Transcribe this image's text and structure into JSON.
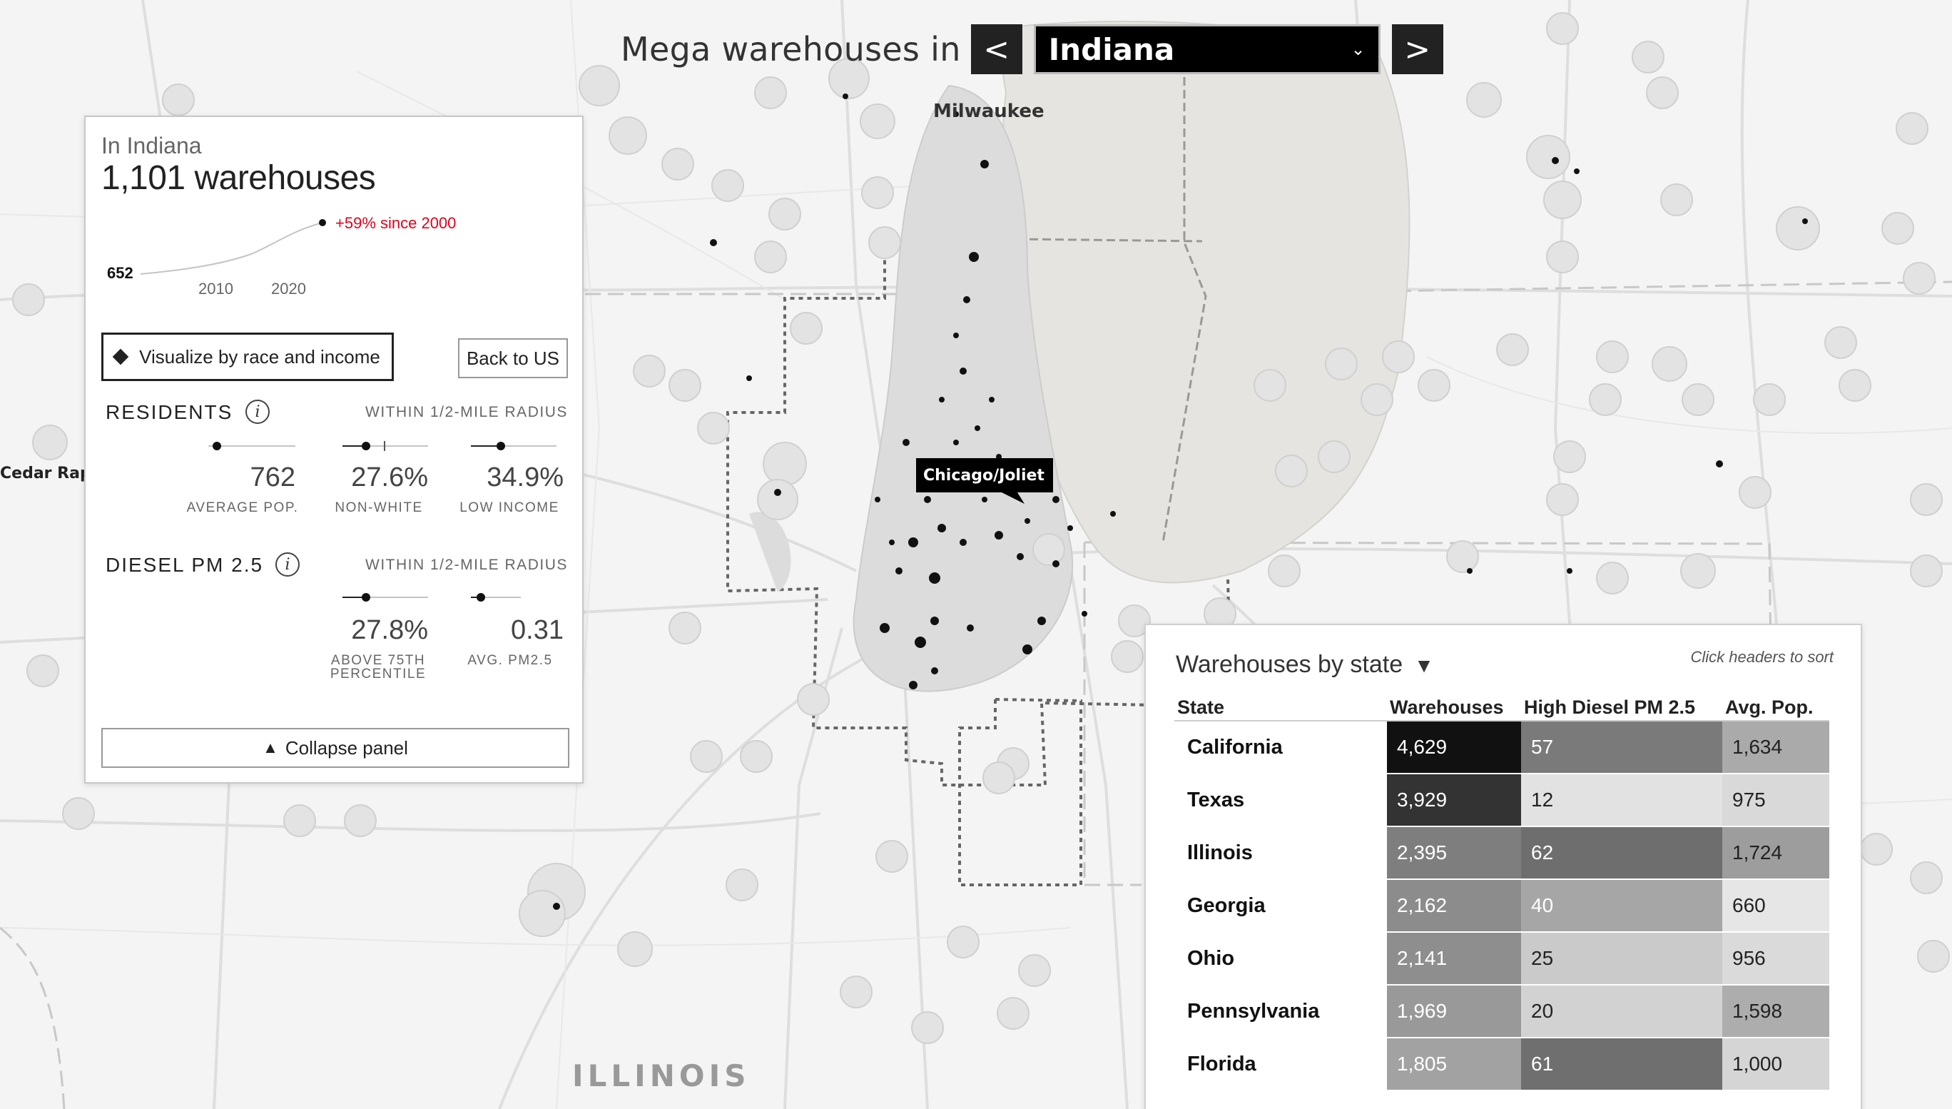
{
  "header": {
    "title": "Mega warehouses in",
    "prev_label": "<",
    "next_label": ">",
    "selected_state": "Indiana"
  },
  "map": {
    "labels": {
      "milwaukee": "Milwaukee",
      "cedar_rapids": "Cedar Rapic",
      "illinois": "ILLINOIS",
      "chicago": "Chicago/Joliet"
    }
  },
  "panel": {
    "subtitle": "In Indiana",
    "count": "1,101 warehouses",
    "spark": {
      "start_value": "652",
      "change": "+59% since 2000",
      "ticks": [
        "2010",
        "2020"
      ]
    },
    "viz_button": "Visualize by race and income",
    "back_button": "Back to US",
    "residents": {
      "title": "RESIDENTS",
      "info": "i",
      "within": "WITHIN 1/2-MILE RADIUS",
      "stats": [
        {
          "value": "762",
          "label": "AVERAGE POP.",
          "fraction": 0.0
        },
        {
          "value": "27.6%",
          "label": "NON-WHITE",
          "fraction": 0.276
        },
        {
          "value": "34.9%",
          "label": "LOW INCOME",
          "fraction": 0.349
        }
      ]
    },
    "diesel": {
      "title": "DIESEL PM 2.5",
      "info": "i",
      "within": "WITHIN 1/2-MILE RADIUS",
      "stats": [
        {
          "value": "27.8%",
          "label_1": "ABOVE 75TH",
          "label_2": "PERCENTILE",
          "fraction": 0.278
        },
        {
          "value": "0.31",
          "label": "AVG. PM2.5",
          "fraction": 0.2
        }
      ]
    },
    "collapse_icon": "▲",
    "collapse_button": "Collapse panel"
  },
  "table": {
    "title": "Warehouses by state",
    "caret": "▼",
    "sort_hint": "Click headers to sort",
    "headers": [
      "State",
      "Warehouses",
      "High Diesel PM 2.5",
      "Avg. Pop."
    ],
    "rows": [
      {
        "state": "California",
        "warehouses": "4,629",
        "diesel": "57",
        "pop": "1,634",
        "c1": "#111111",
        "c2": "#7a7a7a",
        "c3": "#aaaaaa",
        "t1": "#ffffff",
        "t2": "#ffffff",
        "t3": "#222222"
      },
      {
        "state": "Texas",
        "warehouses": "3,929",
        "diesel": "12",
        "pop": "975",
        "c1": "#333333",
        "c2": "#e2e2e2",
        "c3": "#d9d9d9",
        "t1": "#ffffff",
        "t2": "#222222",
        "t3": "#222222"
      },
      {
        "state": "Illinois",
        "warehouses": "2,395",
        "diesel": "62",
        "pop": "1,724",
        "c1": "#7e7e7e",
        "c2": "#6e6e6e",
        "c3": "#9d9d9d",
        "t1": "#ffffff",
        "t2": "#ffffff",
        "t3": "#222222"
      },
      {
        "state": "Georgia",
        "warehouses": "2,162",
        "diesel": "40",
        "pop": "660",
        "c1": "#8c8c8c",
        "c2": "#a6a6a6",
        "c3": "#e6e6e6",
        "t1": "#ffffff",
        "t2": "#ffffff",
        "t3": "#222222"
      },
      {
        "state": "Ohio",
        "warehouses": "2,141",
        "diesel": "25",
        "pop": "956",
        "c1": "#8e8e8e",
        "c2": "#cacaca",
        "c3": "#dadada",
        "t1": "#ffffff",
        "t2": "#222222",
        "t3": "#222222"
      },
      {
        "state": "Pennsylvania",
        "warehouses": "1,969",
        "diesel": "20",
        "pop": "1,598",
        "c1": "#999999",
        "c2": "#d2d2d2",
        "c3": "#adadad",
        "t1": "#ffffff",
        "t2": "#222222",
        "t3": "#222222"
      },
      {
        "state": "Florida",
        "warehouses": "1,805",
        "diesel": "61",
        "pop": "1,000",
        "c1": "#a2a2a2",
        "c2": "#6f6f6f",
        "c3": "#d5d5d5",
        "t1": "#ffffff",
        "t2": "#ffffff",
        "t3": "#222222"
      }
    ]
  }
}
